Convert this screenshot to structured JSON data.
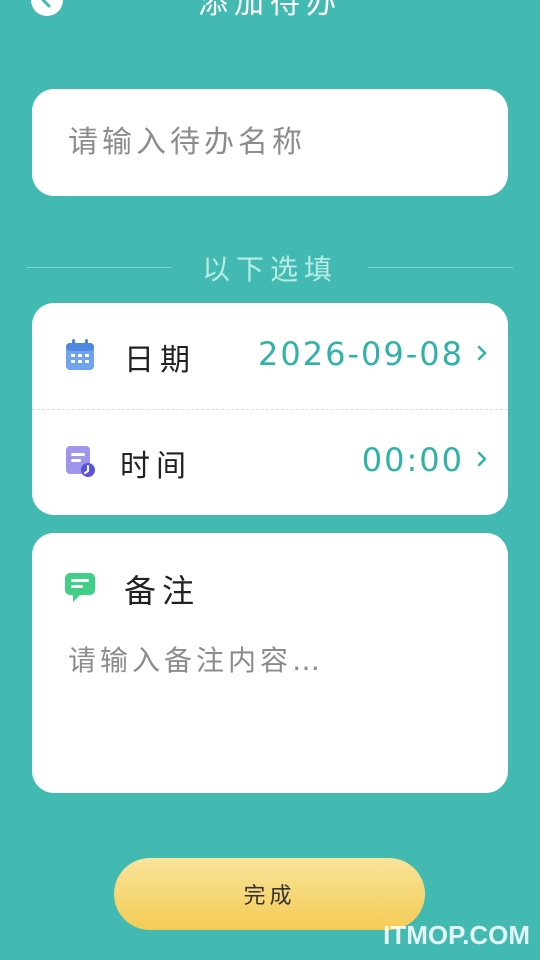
{
  "header": {
    "title": "添加待办",
    "back_icon": "back-arrow-icon"
  },
  "task_name": {
    "placeholder": "请输入待办名称",
    "value": ""
  },
  "optional_section": {
    "label": "以下选填"
  },
  "date_row": {
    "icon": "calendar-icon",
    "label": "日期",
    "value": "2026-09-08"
  },
  "time_row": {
    "icon": "clock-document-icon",
    "label": "时间",
    "value": "00:00"
  },
  "note": {
    "icon": "chat-bubble-icon",
    "label": "备注",
    "placeholder": "请输入备注内容…",
    "value": ""
  },
  "done_button": {
    "label": "完成"
  },
  "watermark": {
    "text": "ITMOP.COM"
  },
  "colors": {
    "background": "#43bab1",
    "accent": "#2fb3a9",
    "button": "#f4cc55"
  }
}
